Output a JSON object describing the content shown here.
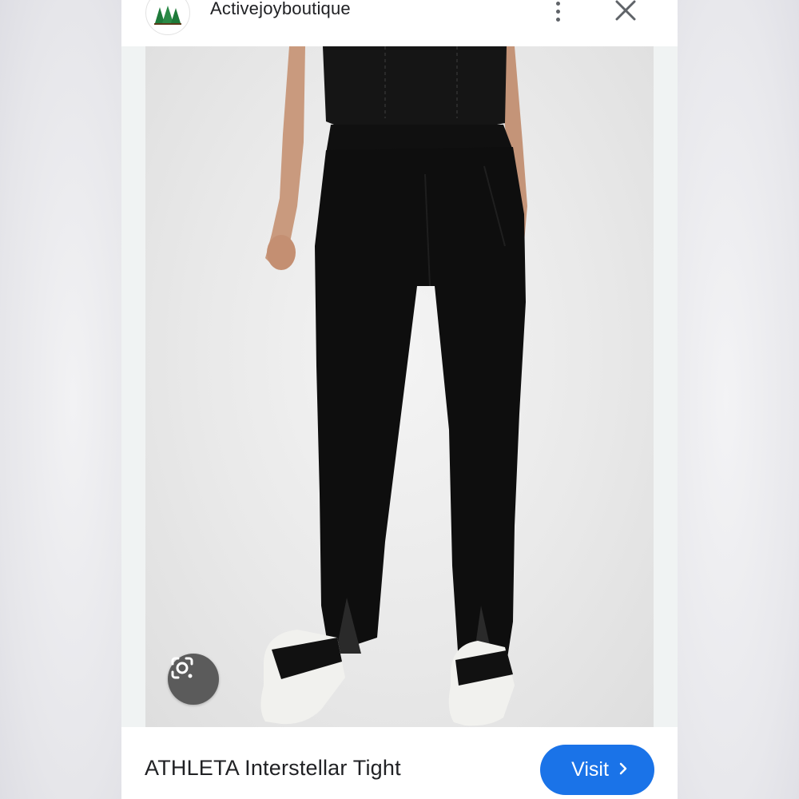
{
  "header": {
    "seller_name": "Activejoyboutique",
    "avatar_icon": "pine-trees-logo",
    "more_icon": "more-vertical-icon",
    "close_icon": "close-icon"
  },
  "image": {
    "lens_icon": "lens-camera-icon"
  },
  "footer": {
    "product_title": "ATHLETA Interstellar Tight",
    "visit_label": "Visit",
    "visit_icon": "chevron-right-icon"
  },
  "colors": {
    "accent": "#1a73e8",
    "text": "#202124",
    "icon": "#5f6368",
    "logo_green": "#1e7a3a"
  }
}
